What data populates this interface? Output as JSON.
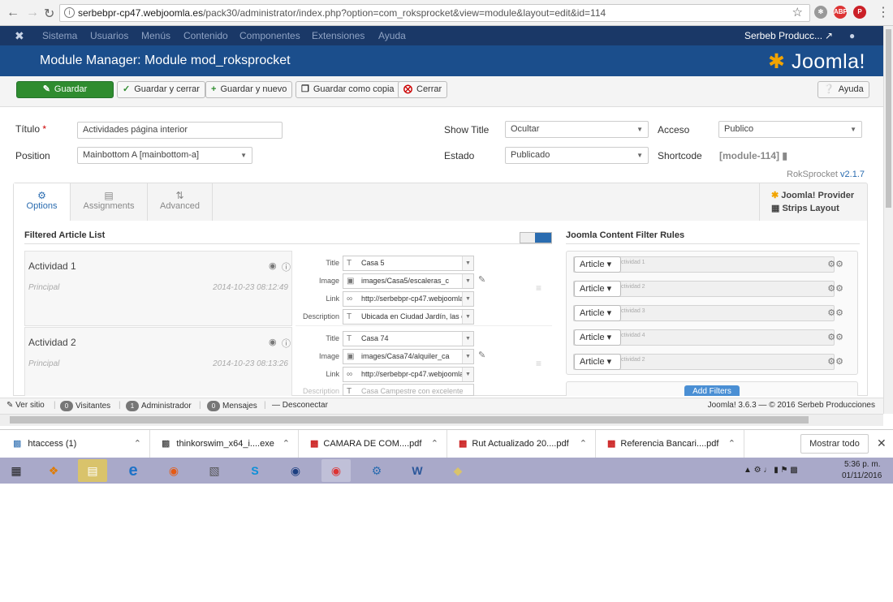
{
  "browser": {
    "url_host": "serbebpr-cp47.webjoomla.es",
    "url_path": "/pack30/administrator/index.php?option=com_roksprocket&view=module&layout=edit&id=114"
  },
  "admin_menu": {
    "items": [
      "Sistema",
      "Usuarios",
      "Menús",
      "Contenido",
      "Componentes",
      "Extensiones",
      "Ayuda"
    ],
    "site_name": "Serbeb Producc..."
  },
  "header": {
    "title": "Module Manager: Module mod_roksprocket",
    "brand": "Joomla!"
  },
  "toolbar": {
    "save": "Guardar",
    "save_close": "Guardar y cerrar",
    "save_new": "Guardar y nuevo",
    "save_copy": "Guardar como copia",
    "close": "Cerrar",
    "help": "Ayuda"
  },
  "form": {
    "title_label": "Título",
    "title_value": "Actividades página interior",
    "position_label": "Position",
    "position_value": "Mainbottom A [mainbottom-a]",
    "show_title_label": "Show Title",
    "show_title_value": "Ocultar",
    "state_label": "Estado",
    "state_value": "Publicado",
    "access_label": "Acceso",
    "access_value": "Publico",
    "shortcode_label": "Shortcode",
    "shortcode_value": "[module-114]",
    "version_prefix": "RokSprocket",
    "version": "v2.1.7"
  },
  "tabs": [
    {
      "label": "Options",
      "icon": "gear-icon"
    },
    {
      "label": "Assignments",
      "icon": "assign-icon"
    },
    {
      "label": "Advanced",
      "icon": "sliders-icon"
    }
  ],
  "provider": {
    "provider": "Joomla! Provider",
    "layout": "Strips Layout"
  },
  "article_list": {
    "title": "Filtered Article List",
    "field_labels": {
      "title": "Title",
      "image": "Image",
      "link": "Link",
      "description": "Description"
    },
    "items": [
      {
        "name": "Actividad 1",
        "category": "Principal",
        "date": "2014-10-23 08:12:49",
        "title": "Casa 5",
        "image": "images/Casa5/escaleras_c",
        "link": "http://serbebpr-cp47.webjoomla",
        "description": "Ubicada en Ciudad Jardín, las c"
      },
      {
        "name": "Actividad 2",
        "category": "Principal",
        "date": "2014-10-23 08:13:26",
        "title": "Casa 74",
        "image": "images/Casa74/alquiler_ca",
        "link": "http://serbebpr-cp47.webjoomla",
        "description": "Casa Campestre con excelente"
      }
    ]
  },
  "filter_rules": {
    "title": "Joomla Content Filter Rules",
    "rules": [
      {
        "type": "Article",
        "value": "ctividad 1"
      },
      {
        "type": "Article",
        "value": "ctividad 2"
      },
      {
        "type": "Article",
        "value": "ctividad 3"
      },
      {
        "type": "Article",
        "value": "ctividad 4"
      },
      {
        "type": "Article",
        "value": "ctividad 2"
      }
    ],
    "add_button": "Add Filters"
  },
  "status": {
    "view_site": "Ver sitio",
    "visitors_count": "0",
    "visitors": "Visitantes",
    "admin_count": "1",
    "admin": "Administrador",
    "messages_count": "0",
    "messages": "Mensajes",
    "logout": "Desconectar",
    "footer": "Joomla! 3.6.3 — © 2016 Serbeb Producciones"
  },
  "downloads": {
    "items": [
      {
        "name": "htaccess (1)"
      },
      {
        "name": "thinkorswim_x64_i....exe"
      },
      {
        "name": "CAMARA DE COM....pdf"
      },
      {
        "name": "Rut Actualizado 20....pdf"
      },
      {
        "name": "Referencia Bancari....pdf"
      }
    ],
    "show_all": "Mostrar todo"
  },
  "taskbar": {
    "time": "5:36 p. m.",
    "date": "01/11/2016"
  },
  "colors": {
    "admin_bar": "#1a3867",
    "title_bar": "#1b4e8c",
    "save_green": "#2f8c2f",
    "taskbar": "#a9a9c9"
  }
}
